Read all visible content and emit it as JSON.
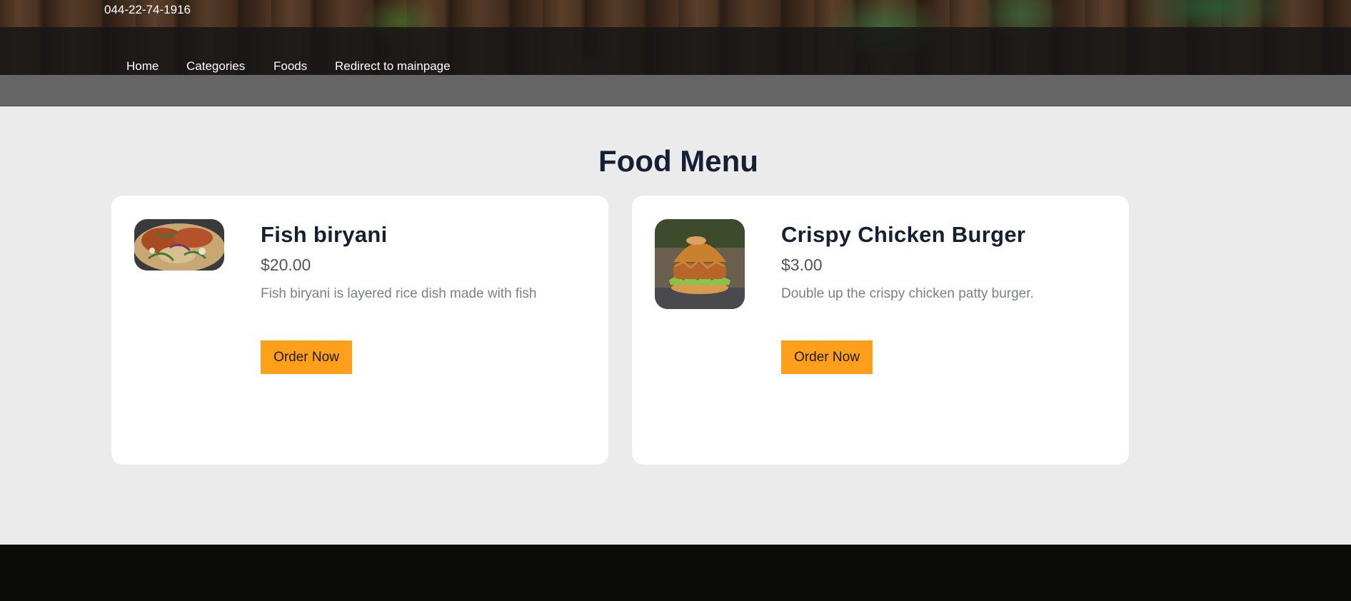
{
  "header": {
    "phone": "044-22-74-1916",
    "nav": [
      {
        "label": "Home"
      },
      {
        "label": "Categories"
      },
      {
        "label": "Foods"
      },
      {
        "label": "Redirect to mainpage"
      }
    ]
  },
  "main": {
    "title": "Food Menu",
    "foods": [
      {
        "name": "Fish biryani",
        "price": "$20.00",
        "description": "Fish biryani is layered rice dish made with fish",
        "button": "Order Now"
      },
      {
        "name": "Crispy Chicken Burger",
        "price": "$3.00",
        "description": "Double up the crispy chicken patty burger.",
        "button": "Order Now"
      }
    ]
  },
  "colors": {
    "accent": "#ff9f1a",
    "heading": "#152034",
    "page_bg": "#ebebeb",
    "footer_bg": "#0b0b0a"
  }
}
